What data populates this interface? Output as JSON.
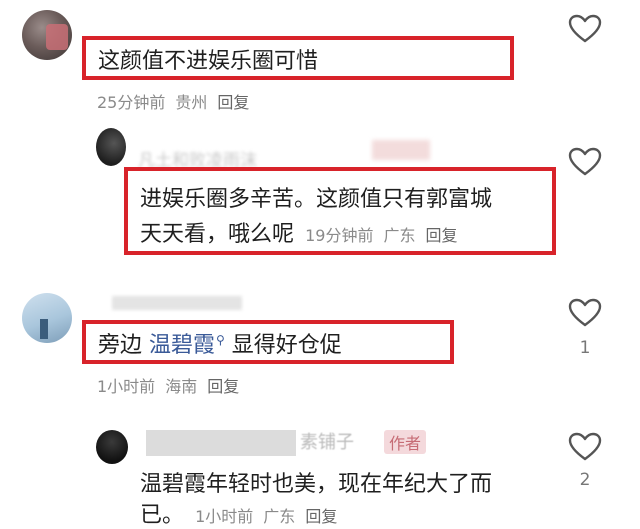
{
  "comments": [
    {
      "text": "这颜值不进娱乐圈可惜",
      "time": "25分钟前",
      "location": "贵州",
      "reply": "回复",
      "likes": ""
    },
    {
      "username": "凡土和败凌雨沫",
      "line1": "进娱乐圈多辛苦。这颜值只有郭富城",
      "line2": "天天看，哦么呢",
      "time": "19分钟前",
      "location": "广东",
      "reply": "回复",
      "likes": ""
    },
    {
      "text_before": "旁边 ",
      "link": "温碧霞",
      "text_after": " 显得好仓促",
      "time": "1小时前",
      "location": "海南",
      "reply": "回复",
      "likes": "1"
    },
    {
      "username": "素铺子",
      "badge": "作者",
      "line1": "温碧霞年轻时也美，现在年纪大了而",
      "line2": "已。",
      "time": "1小时前",
      "location": "广东",
      "reply": "回复",
      "likes": "2"
    }
  ],
  "icons": {
    "like": "heart-outline-icon",
    "search": "search-icon"
  },
  "colors": {
    "highlight_border": "#d8232a",
    "link": "#3a5a98",
    "meta": "#8a8a8a"
  }
}
